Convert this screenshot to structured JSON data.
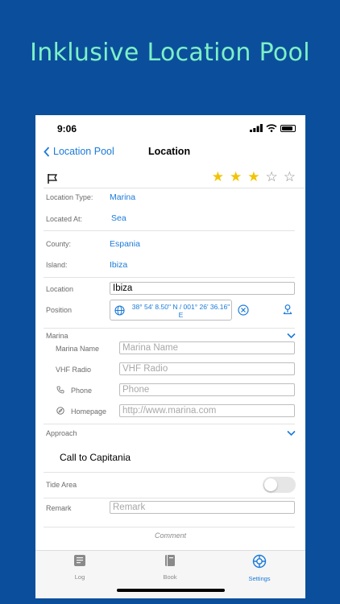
{
  "headline": "Inklusive Location Pool",
  "status": {
    "time": "9:06"
  },
  "nav": {
    "back_label": "Location Pool",
    "title": "Location"
  },
  "rating": {
    "value": 3,
    "max": 5,
    "filled_color": "#f2c300"
  },
  "details": {
    "location_type": {
      "label": "Location Type:",
      "value": "Marina"
    },
    "located_at": {
      "label": "Located At:",
      "value": "Sea"
    },
    "county": {
      "label": "County:",
      "value": "Espania"
    },
    "island": {
      "label": "Island:",
      "value": "Ibiza"
    }
  },
  "location": {
    "label": "Location",
    "value": "Ibiza"
  },
  "position": {
    "label": "Position",
    "value": "38° 54' 8.50\" N / 001° 26' 36.16\" E"
  },
  "marina": {
    "section_label": "Marina",
    "name": {
      "label": "Marina Name",
      "placeholder": "Marina Name"
    },
    "vhf": {
      "label": "VHF Radio",
      "placeholder": "VHF Radio"
    },
    "phone": {
      "label": "Phone",
      "placeholder": "Phone"
    },
    "homepage": {
      "label": "Homepage",
      "placeholder": "http://www.marina.com"
    }
  },
  "approach": {
    "label": "Approach"
  },
  "call_button": "Call to Capitania",
  "tide_area": {
    "label": "Tide Area",
    "enabled": false
  },
  "remark": {
    "label": "Remark",
    "placeholder": "Remark"
  },
  "comment_label": "Comment",
  "tabs": [
    {
      "label": "Log",
      "icon": "log-icon",
      "active": false
    },
    {
      "label": "Book",
      "icon": "book-icon",
      "active": false
    },
    {
      "label": "Settings",
      "icon": "settings-icon",
      "active": true
    }
  ],
  "colors": {
    "background": "#0b4f9c",
    "headline": "#7df0c6",
    "accent": "#1a7ad9"
  }
}
